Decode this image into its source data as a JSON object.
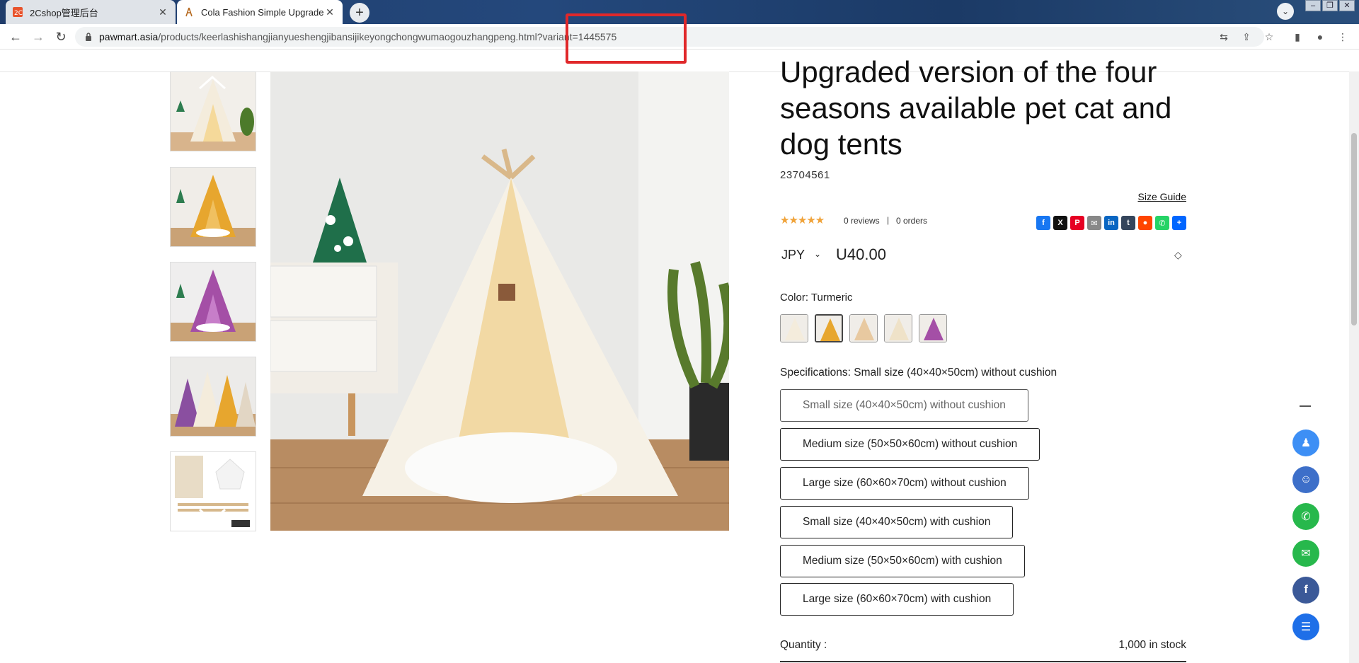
{
  "browser": {
    "tabs": [
      {
        "title": "2Cshop管理后台",
        "active": false
      },
      {
        "title": "Cola Fashion Simple Upgraded",
        "active": true
      }
    ],
    "url_host": "pawmart.asia",
    "url_path": "/products/keerlashishangjianyueshengjibansijikeyongchongwumaogouzhangpeng.html?variant=1445575"
  },
  "product": {
    "title": "Upgraded version of the four seasons available pet cat and dog tents",
    "sku": "23704561",
    "size_guide": "Size Guide",
    "stars": "★★★★★",
    "reviews": "0 reviews",
    "separator": "|",
    "orders": "0 orders",
    "currency": "JPY",
    "price": "U40.00",
    "color_label": "Color: Turmeric",
    "spec_label": "Specifications: Small size (40×40×50cm) without cushion",
    "specs": [
      "Small size (40×40×50cm) without cushion",
      "Medium size (50×50×60cm) without cushion",
      "Large size (60×60×70cm) without cushion",
      "Small size (40×40×50cm) with cushion",
      "Medium size (50×50×60cm) with cushion",
      "Large size (60×60×70cm) with cushion"
    ],
    "quantity_label": "Quantity :",
    "stock": "1,000 in stock"
  },
  "share": [
    {
      "name": "facebook-icon",
      "glyph": "f",
      "color": "#1877f2"
    },
    {
      "name": "x-icon",
      "glyph": "X",
      "color": "#111111"
    },
    {
      "name": "pinterest-icon",
      "glyph": "P",
      "color": "#e60023"
    },
    {
      "name": "email-icon",
      "glyph": "✉",
      "color": "#888888"
    },
    {
      "name": "linkedin-icon",
      "glyph": "in",
      "color": "#0a66c2"
    },
    {
      "name": "tumblr-icon",
      "glyph": "t",
      "color": "#35465c"
    },
    {
      "name": "reddit-icon",
      "glyph": "●",
      "color": "#ff4500"
    },
    {
      "name": "whatsapp-icon",
      "glyph": "✆",
      "color": "#25d366"
    },
    {
      "name": "share-plus-icon",
      "glyph": "+",
      "color": "#0166ff"
    }
  ],
  "floating": [
    {
      "name": "qq-icon",
      "color": "#3d8ff5",
      "glyph": "♟"
    },
    {
      "name": "robot-chat-icon",
      "color": "#3d6fc9",
      "glyph": "☺"
    },
    {
      "name": "whatsapp-float-icon",
      "color": "#27b84c",
      "glyph": "✆"
    },
    {
      "name": "wechat-icon",
      "color": "#27b84c",
      "glyph": "✉"
    },
    {
      "name": "facebook-float-icon",
      "color": "#3b5998",
      "glyph": "f"
    },
    {
      "name": "messenger-icon",
      "color": "#1e6fe8",
      "glyph": "☰"
    }
  ]
}
